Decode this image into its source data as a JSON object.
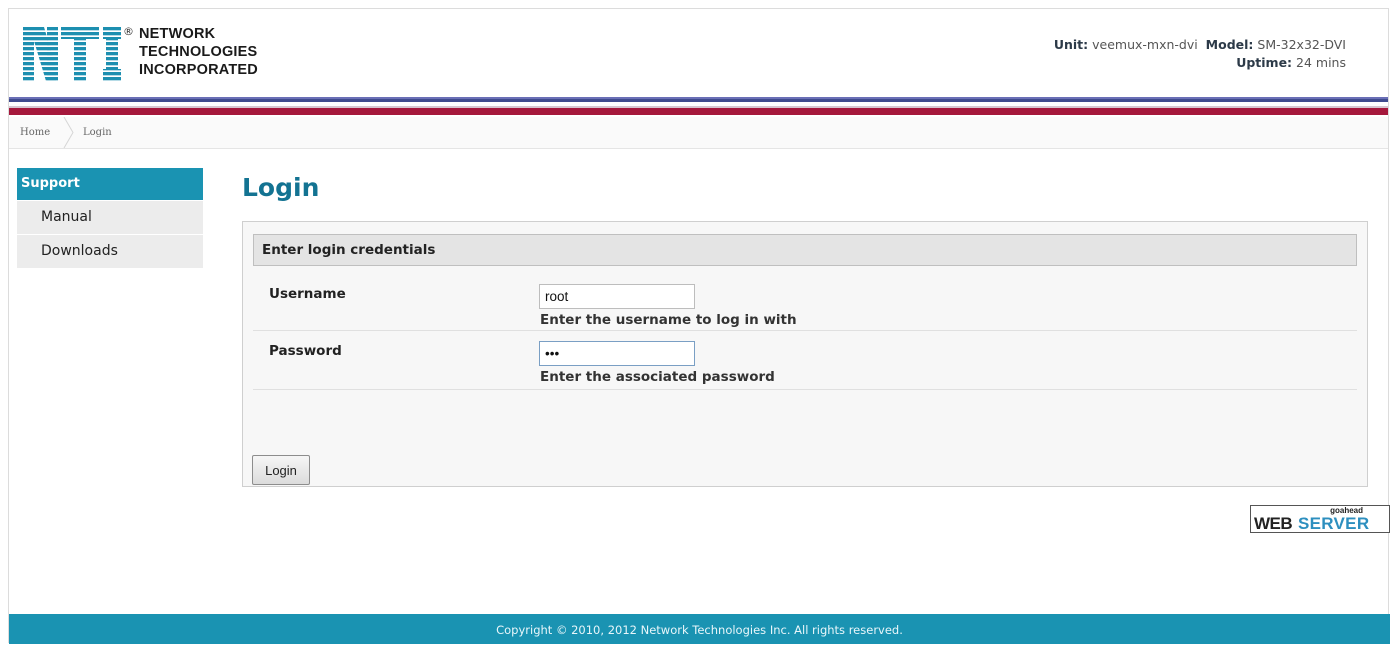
{
  "header": {
    "logo": {
      "mark": "NTI",
      "registered": "®",
      "lines": [
        "NETWORK",
        "TECHNOLOGIES",
        "INCORPORATED"
      ]
    },
    "unit_label": "Unit:",
    "unit_value": "veemux-mxn-dvi",
    "model_label": "Model:",
    "model_value": "SM-32x32-DVI",
    "uptime_label": "Uptime:",
    "uptime_value": "24 mins",
    "stripe_colors": [
      "#6a6fb6",
      "#3f4b8e",
      "#a5183c"
    ]
  },
  "breadcrumb": {
    "home": "Home",
    "current": "Login"
  },
  "sidebar": {
    "heading": "Support",
    "items": [
      {
        "label": "Manual"
      },
      {
        "label": "Downloads"
      }
    ]
  },
  "main": {
    "title": "Login",
    "panel_heading": "Enter login credentials",
    "fields": {
      "username": {
        "label": "Username",
        "value": "root",
        "help": "Enter the username to log in with"
      },
      "password": {
        "label": "Password",
        "value": "abc",
        "help": "Enter the associated password"
      }
    },
    "submit_label": "Login"
  },
  "badge": {
    "small": "goahead",
    "web": "WEB",
    "server": "SERVER"
  },
  "footer": {
    "copyright": "Copyright © 2010, 2012 Network Technologies Inc. All rights reserved."
  },
  "colors": {
    "accent": "#1a93b2",
    "title": "#137392",
    "brand_red": "#a5183c"
  }
}
